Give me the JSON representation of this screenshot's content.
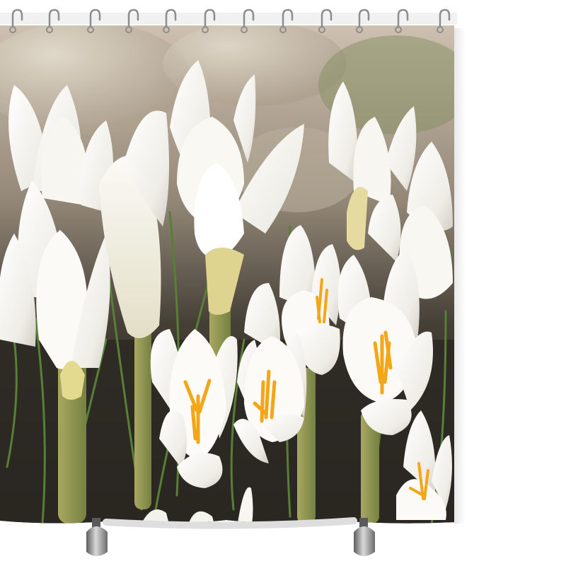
{
  "image": {
    "subject": "shower-curtain-product-photo",
    "print": "white-crocus-flowers",
    "colors": {
      "background": "#ffffff",
      "rod": "#e9e9e9",
      "hook_metal": "#8d8d8d",
      "petal": "#f4f3ee",
      "petal_shadow": "#cfcdc2",
      "stamen": "#f2a20c",
      "stem": "#7e8b3f",
      "leaf": "#4f7a2c",
      "ground_dark": "#1d1a15",
      "rock": "#bdb2a1"
    }
  }
}
